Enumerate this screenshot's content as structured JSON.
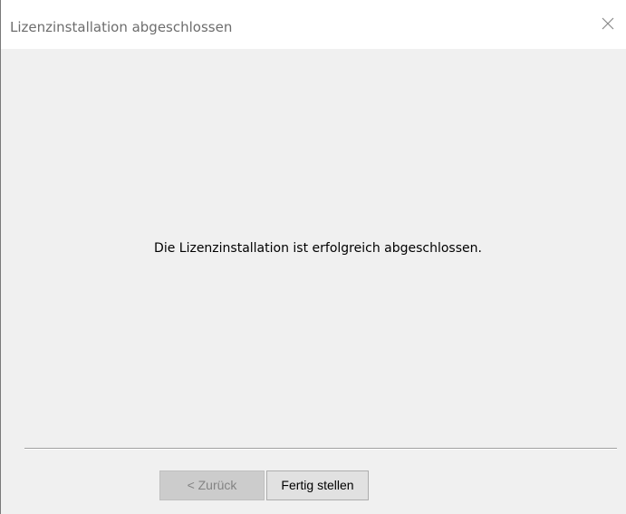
{
  "window": {
    "title": "Lizenzinstallation abgeschlossen",
    "close_icon": "close-icon"
  },
  "content": {
    "message": "Die Lizenzinstallation ist erfolgreich abgeschlossen."
  },
  "buttons": {
    "back_label": "< Zurück",
    "back_enabled": false,
    "finish_label": "Fertig stellen",
    "finish_enabled": true
  }
}
